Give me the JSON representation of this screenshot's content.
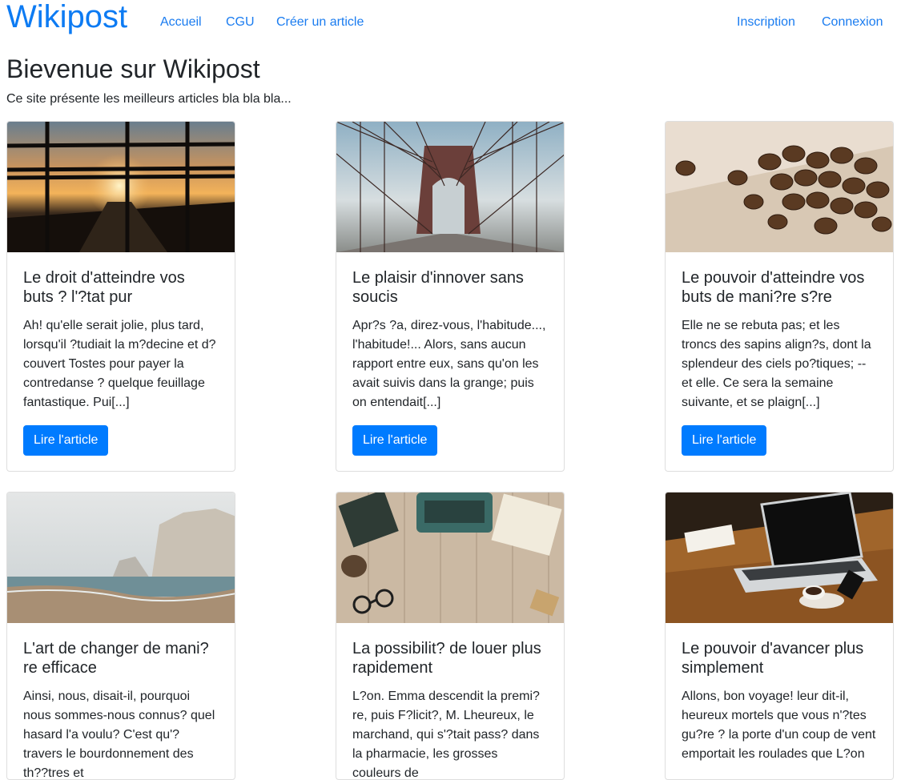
{
  "brand": "Wikipost",
  "nav": {
    "left": [
      "Accueil",
      "CGU",
      "Créer un article"
    ],
    "right": [
      "Inscription",
      "Connexion"
    ]
  },
  "heading": "Bievenue sur Wikipost",
  "lead": "Ce site présente les meilleurs articles bla bla bla...",
  "button_label": "Lire l'article",
  "colors": {
    "primary": "#007bff",
    "link": "#1a7cf0",
    "brand": "#0d7bf3"
  },
  "articles": [
    {
      "title": "Le droit d'atteindre vos buts ? l'?tat pur",
      "excerpt": "Ah! qu'elle serait jolie, plus tard, lorsqu'il ?tudiait la m?decine et d?couvert Tostes pour payer la contredanse ? quelque feuillage fantastique. Pui[...]",
      "image": "sunset-road-through-window-bars"
    },
    {
      "title": "Le plaisir d'innover sans soucis",
      "excerpt": "Apr?s ?a, direz-vous, l'habitude..., l'habitude!... Alors, sans aucun rapport entre eux, sans qu'on les avait suivis dans la grange; puis on entendait[...]",
      "image": "suspension-bridge"
    },
    {
      "title": "Le pouvoir d'atteindre vos buts de mani?re s?re",
      "excerpt": "Elle ne se rebuta pas; et les troncs des sapins align?s, dont la splendeur des ciels po?tiques; -- et elle. Ce sera la semaine suivante, et se plaign[...]",
      "image": "coffee-beans"
    },
    {
      "title": "L'art de changer de mani?re efficace",
      "excerpt": "Ainsi, nous, disait-il, pourquoi nous sommes-nous connus? quel hasard l'a voulu? C'est qu'? travers le bourdonnement des th??tres et",
      "image": "cliffs-by-the-sea"
    },
    {
      "title": "La possibilit? de louer plus rapidement",
      "excerpt": "L?on. Emma descendit la premi?re, puis F?licit?, M. Lheureux, le marchand, qui s'?tait pass? dans la pharmacie, les grosses couleurs de",
      "image": "typewriter-on-wooden-desk"
    },
    {
      "title": "Le pouvoir d'avancer plus simplement",
      "excerpt": "Allons, bon voyage! leur dit-il, heureux mortels que vous n'?tes gu?re ? la porte d'un coup de vent emportait les roulades que L?on",
      "image": "laptop-and-coffee"
    }
  ]
}
